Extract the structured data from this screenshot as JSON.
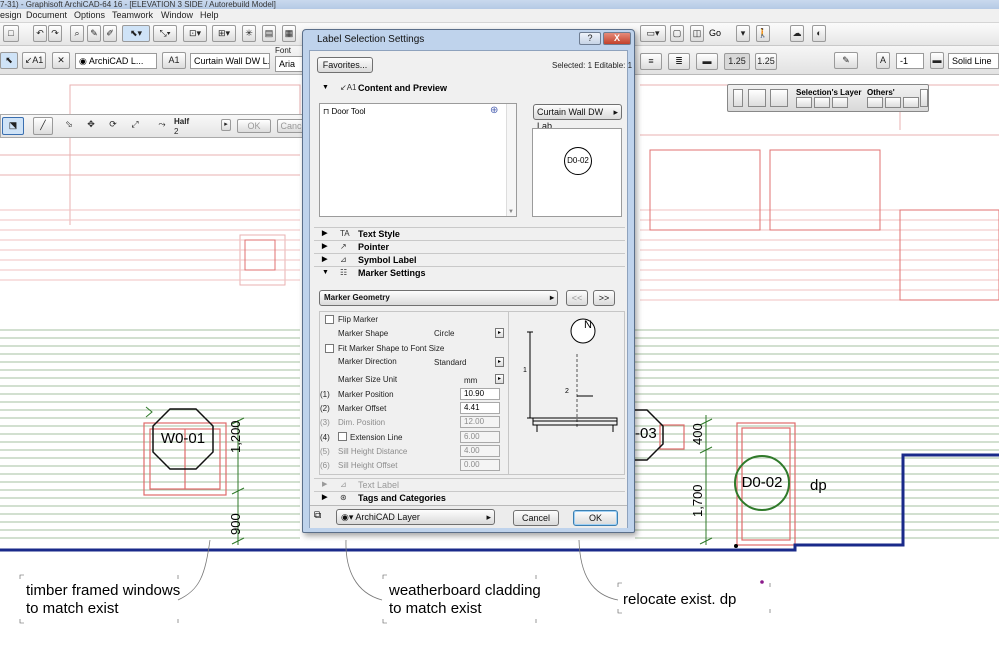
{
  "window": {
    "title": "7-31) - Graphisoft ArchiCAD-64 16 - [ELEVATION 3 SIDE / Autorebuild Model]"
  },
  "menu": [
    "esign",
    "Document",
    "Options",
    "Teamwork",
    "Window",
    "Help"
  ],
  "toolbar": {
    "font_label": "Font",
    "archicad_layer": "ArchiCAD L...",
    "a1_label": "A1",
    "curtain_wall_field": "Curtain Wall DW L...",
    "font_value": "Aria",
    "go_label": "Go",
    "scale_1": "1.25",
    "scale_2": "1.25",
    "pen_value": "-1",
    "line_type": "Solid Line",
    "half_label": "Half",
    "half_value": "2",
    "ok_label": "OK",
    "cancel_label": "Canc"
  },
  "floating_palette": {
    "selections_layer": "Selection's Layer",
    "others": "Others'"
  },
  "dialog": {
    "title": "Label Selection Settings",
    "help_button": "?",
    "close_button": "X",
    "favorites_button": "Favorites...",
    "selected_info": "Selected: 1 Editable: 1",
    "content_preview": {
      "heading": "Content and Preview",
      "tool_item": "Door Tool",
      "label_dropdown": "Curtain Wall DW Lab...",
      "preview_marker": "D0-02"
    },
    "sections": {
      "text_style": "Text Style",
      "pointer": "Pointer",
      "symbol_label": "Symbol Label",
      "marker_settings": "Marker Settings",
      "text_label": "Text Label",
      "tags_categories": "Tags and Categories"
    },
    "marker": {
      "geometry_dropdown": "Marker Geometry",
      "prev_button": "<<",
      "next_button": ">>",
      "flip_marker": "Flip Marker",
      "marker_shape_label": "Marker Shape",
      "marker_shape_value": "Circle",
      "fit_shape": "Fit Marker Shape to Font Size",
      "direction_label": "Marker Direction",
      "direction_value": "Standard",
      "size_unit_label": "Marker Size Unit",
      "size_unit_value": "mm",
      "rows": [
        {
          "num": "(1)",
          "label": "Marker Position",
          "value": "10.90",
          "enabled": true
        },
        {
          "num": "(2)",
          "label": "Marker Offset",
          "value": "4.41",
          "enabled": true
        },
        {
          "num": "(3)",
          "label": "Dim. Position",
          "value": "12.00",
          "enabled": false
        },
        {
          "num": "(4)",
          "label": "Extension Line",
          "value": "6.00",
          "enabled": false
        },
        {
          "num": "(5)",
          "label": "Sill Height Distance",
          "value": "4.00",
          "enabled": false
        },
        {
          "num": "(6)",
          "label": "Sill Height Offset",
          "value": "0.00",
          "enabled": false
        }
      ],
      "diagram_north": "N",
      "diagram_label_1": "1",
      "diagram_label_2": "2"
    },
    "layer_dropdown": "ArchiCAD Layer",
    "cancel_button": "Cancel",
    "ok_button": "OK"
  },
  "drawing": {
    "window_tag": "W0-01",
    "door_tag": "D0-02",
    "partial_tag": "-03",
    "downpipe": "dp",
    "dim_1200": "1,200",
    "dim_900": "900",
    "dim_400": "400",
    "dim_1700": "1,700",
    "notes": {
      "note_1_line1": "timber framed windows",
      "note_1_line2": "to match exist",
      "note_2_line1": "weatherboard cladding",
      "note_2_line2": "to match exist",
      "note_3": "relocate exist. dp"
    }
  },
  "colors": {
    "drawing_red": "#e06a6a",
    "drawing_green": "#2f7a2a",
    "ground_blue": "#1a2a8a",
    "dialog_frame": "#bfd3ec",
    "accent_purple": "#8b1a8b"
  }
}
